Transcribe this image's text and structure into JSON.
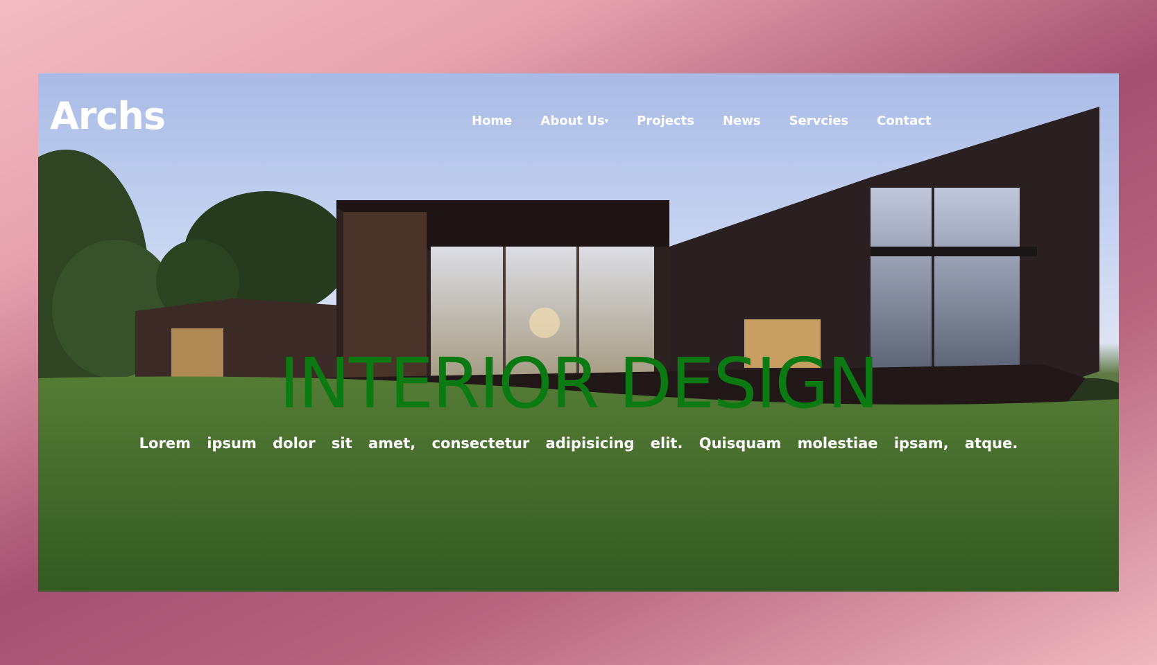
{
  "header": {
    "logo": "Archs",
    "nav": [
      {
        "label": "Home"
      },
      {
        "label": "About Us",
        "caret": "▾"
      },
      {
        "label": "Projects"
      },
      {
        "label": "News"
      },
      {
        "label": "Servcies"
      },
      {
        "label": "Contact"
      }
    ]
  },
  "hero": {
    "title": "INTERIOR DESIGN",
    "subtitle": "Lorem ipsum dolor sit amet, consectetur adipisicing elit. Quisquam molestiae ipsam, atque.",
    "title_color": "#0b7a12",
    "background_image": "modern dark-clad house on green lawn at dusk"
  },
  "colors": {
    "page_gradient_light": "#f3bcc2",
    "page_gradient_dark": "#a4506f",
    "nav_text": "#ffffff"
  }
}
